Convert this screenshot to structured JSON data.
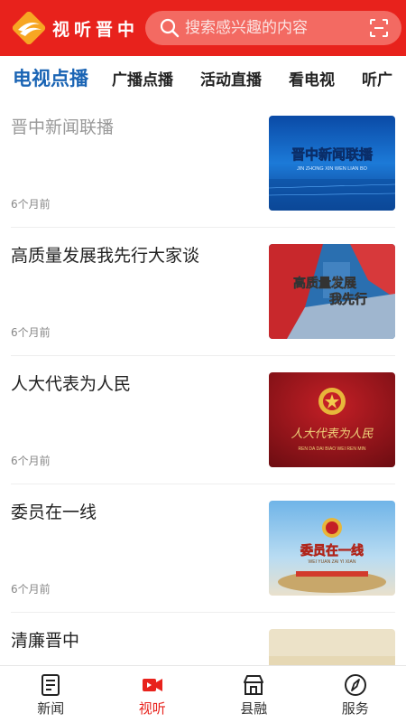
{
  "header": {
    "logo_text": "视听晋中",
    "search_placeholder": "搜索感兴趣的内容",
    "brand_color": "#e8221c"
  },
  "tabs": [
    {
      "label": "电视点播",
      "active": true
    },
    {
      "label": "广播点播",
      "active": false
    },
    {
      "label": "活动直播",
      "active": false
    },
    {
      "label": "看电视",
      "active": false
    },
    {
      "label": "听广",
      "active": false
    }
  ],
  "items": [
    {
      "title": "晋中新闻联播",
      "time": "6个月前",
      "read": true,
      "thumb": {
        "title": "晋中新闻联播",
        "subtitle": "JIN ZHONG XIN WEN LIAN BO"
      }
    },
    {
      "title": "高质量发展我先行大家谈",
      "time": "6个月前",
      "read": false,
      "thumb": {
        "line1": "高质量发展",
        "line2": "我先行"
      }
    },
    {
      "title": "人大代表为人民",
      "time": "6个月前",
      "read": false,
      "thumb": {
        "title": "人大代表为人民",
        "subtitle": "REN DA DAI BIAO WEI REN MIN"
      }
    },
    {
      "title": "委员在一线",
      "time": "6个月前",
      "read": false,
      "thumb": {
        "title": "委员在一线",
        "subtitle": "WEI YUAN ZAI YI XIAN"
      }
    },
    {
      "title": "清廉晋中",
      "time": "",
      "read": false,
      "thumb": {}
    }
  ],
  "bottom_nav": [
    {
      "label": "新闻",
      "icon": "news-icon",
      "active": false
    },
    {
      "label": "视听",
      "icon": "video-icon",
      "active": true
    },
    {
      "label": "县融",
      "icon": "county-icon",
      "active": false
    },
    {
      "label": "服务",
      "icon": "compass-icon",
      "active": false
    }
  ]
}
